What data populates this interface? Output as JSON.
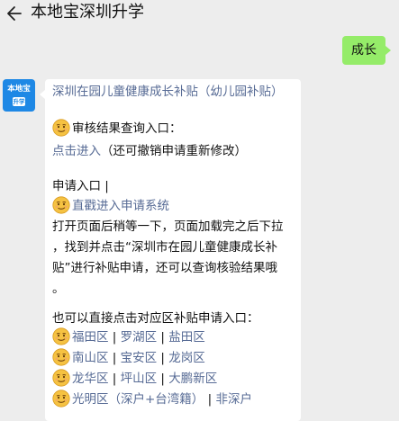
{
  "header": {
    "title": "本地宝深圳升学"
  },
  "sent": {
    "text": "成长"
  },
  "avatar": {
    "line1": "本地宝",
    "line2": "升学"
  },
  "message": {
    "title": "深圳在园儿童健康成长补贴（幼儿园补贴）",
    "audit_label": "审核结果查询入口：",
    "click_enter": "点击进入",
    "click_enter_note": "（还可撤销申请重新修改）",
    "apply_label": "申请入口 |",
    "apply_link": "直戳进入申请系统",
    "instructions": [
      "打开页面后稍等一下，页面加载完之后下拉",
      "，找到并点击“深圳市在园儿童健康成长补",
      "贴”进行补贴申请，还可以查询核验结果哦",
      "。"
    ],
    "district_intro": "也可以直接点击对应区补贴申请入口：",
    "district_rows": [
      [
        "福田区",
        "罗湖区",
        "盐田区"
      ],
      [
        "南山区",
        "宝安区",
        "龙岗区"
      ],
      [
        "龙华区",
        "坪山区",
        "大鹏新区"
      ],
      [
        "光明区（深户+台湾籍）",
        "非深户"
      ]
    ],
    "separator": " | "
  },
  "colors": {
    "background": "#ededed",
    "sent_bubble": "#95ec69",
    "link": "#576b95",
    "avatar": "#1e88e5",
    "emoji": "#f5c242"
  },
  "icons": {
    "back": "arrow-left-icon",
    "emoji": "smirk-face-emoji-icon"
  }
}
